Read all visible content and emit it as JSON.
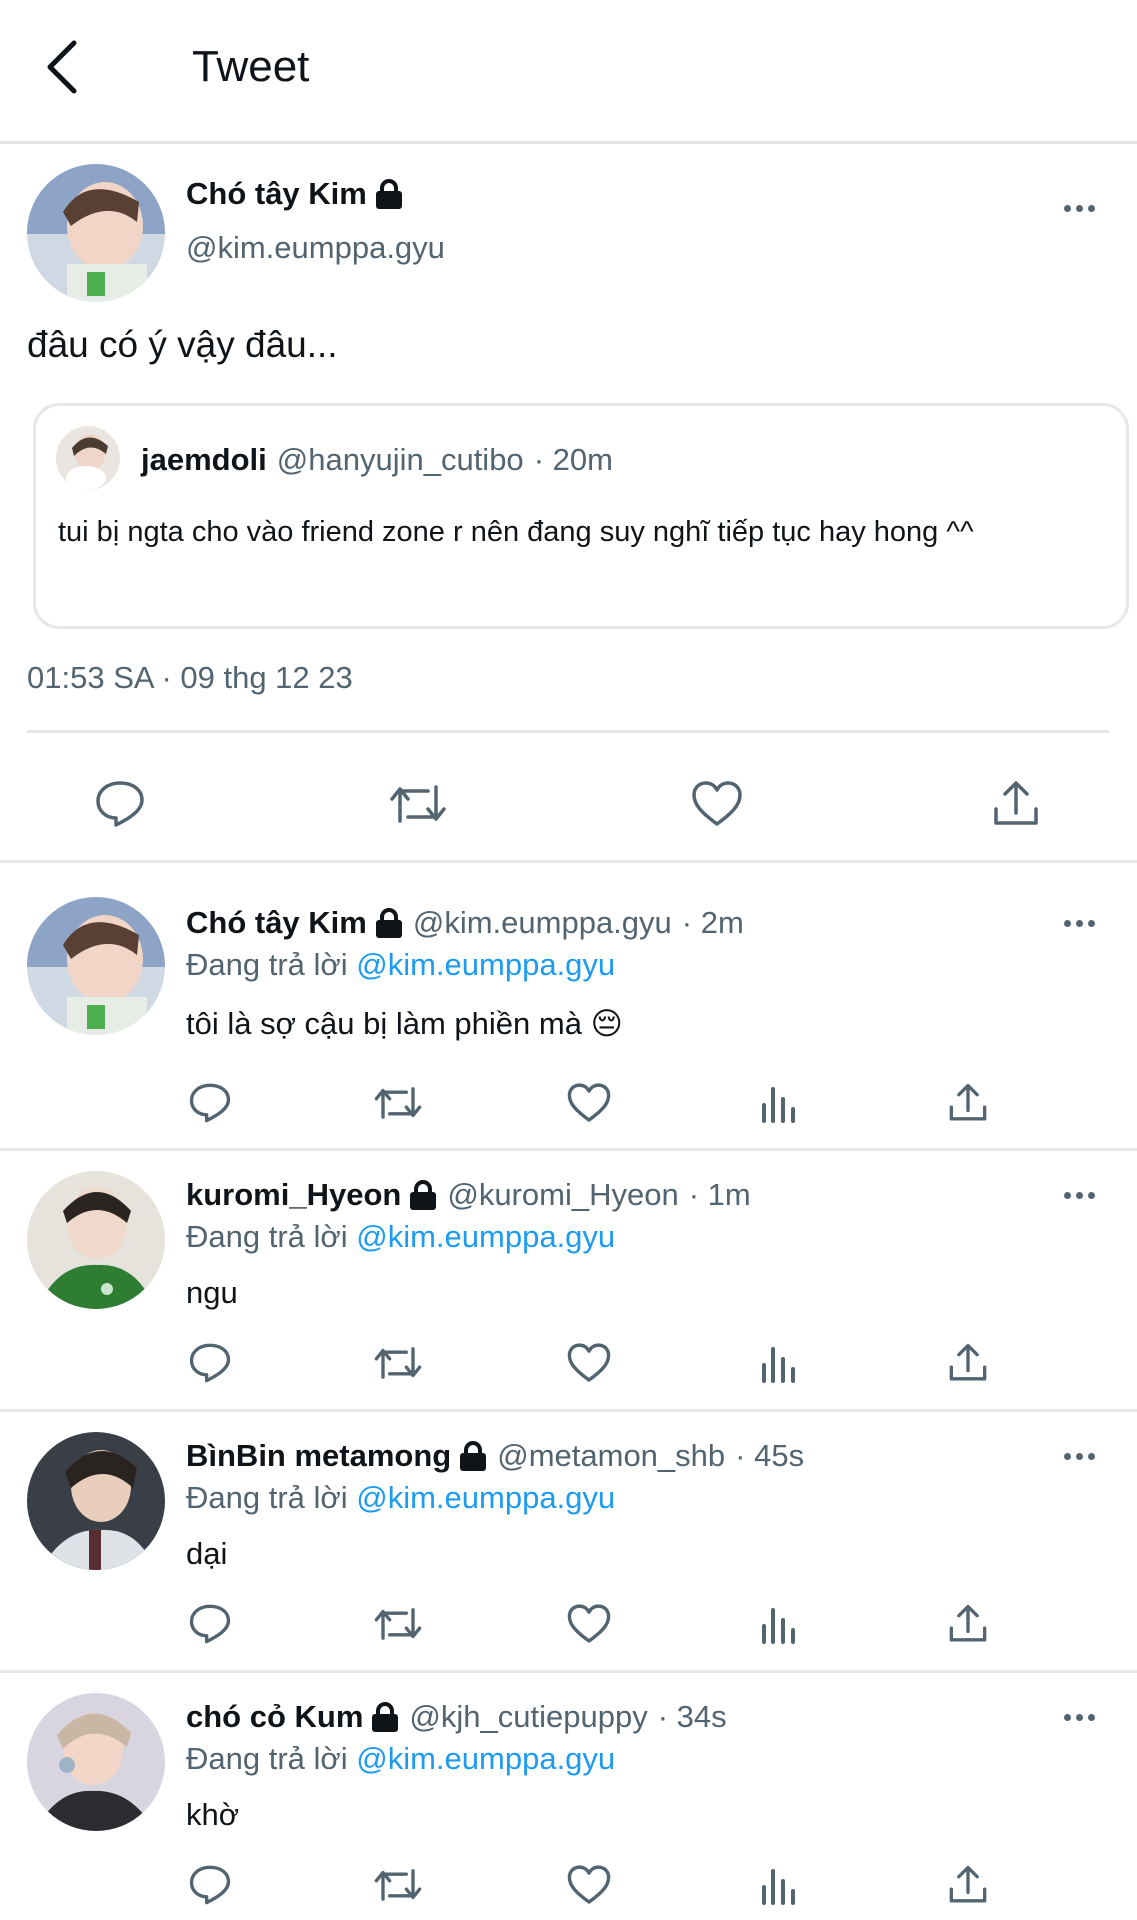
{
  "header": {
    "title": "Tweet"
  },
  "main_tweet": {
    "author_name": "Chó tây Kim",
    "author_handle": "@kim.eumppa.gyu",
    "text": "đâu có ý vậy đâu...",
    "quote": {
      "author_name": "jaemdoli",
      "author_handle": "@hanyujin_cutibo",
      "time": "· 20m",
      "text": "tui bị ngta cho vào friend zone r nên đang suy nghĩ tiếp tục hay hong ^^"
    },
    "timestamp": "01:53 SA · 09 thg 12 23"
  },
  "replies": [
    {
      "name": "Chó tây Kim",
      "handle": "@kim.eumppa.gyu",
      "time": "· 2m",
      "replying_label": "Đang trả lời",
      "replying_to": "@kim.eumppa.gyu",
      "text": "tôi là sợ cậu bị làm phiền mà 😔"
    },
    {
      "name": "kuromi_Hyeon",
      "handle": "@kuromi_Hyeon",
      "time": "· 1m",
      "replying_label": "Đang trả lời",
      "replying_to": "@kim.eumppa.gyu",
      "text": "ngu"
    },
    {
      "name": "BìnBin metamong",
      "handle": "@metamon_shb",
      "time": "· 45s",
      "replying_label": "Đang trả lời",
      "replying_to": "@kim.eumppa.gyu",
      "text": "dại"
    },
    {
      "name": "chó cỏ Kum",
      "handle": "@kjh_cutiepuppy",
      "time": "· 34s",
      "replying_label": "Đang trả lời",
      "replying_to": "@kim.eumppa.gyu",
      "text": "khờ"
    }
  ],
  "colors": {
    "text": "#0f1419",
    "muted": "#536471",
    "link": "#1d9bf0",
    "divider": "#e5e8eb"
  },
  "icons": [
    "chevron-left-icon",
    "lock-icon",
    "more-icon",
    "reply-icon",
    "retweet-icon",
    "like-icon",
    "analytics-icon",
    "share-icon"
  ]
}
